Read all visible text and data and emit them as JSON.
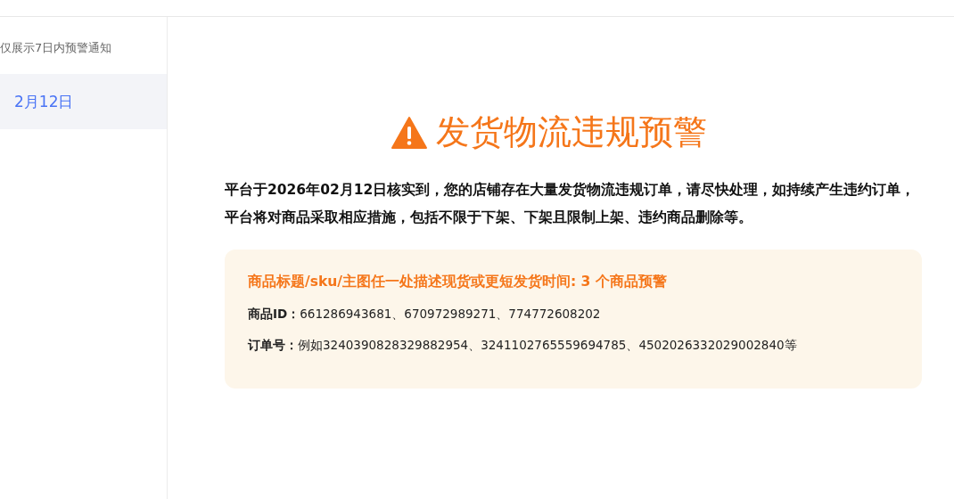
{
  "sidebar": {
    "note": "仅展示7日内预警通知",
    "items": [
      {
        "label": "2月12日",
        "selected": true
      }
    ]
  },
  "alert": {
    "title": "发货物流违规预警",
    "message": "平台于2026年02月12日核实到，您的店铺存在大量发货物流违规订单，请尽快处理，如持续产生违约订单，平台将对商品采取相应措施，包括不限于下架、下架且限制上架、违约商品删除等。",
    "card": {
      "heading": "商品标题/sku/主图任一处描述现货或更短发货时间: 3 个商品预警",
      "lines": [
        "**商品ID：**661286943681、670972989271、774772608202",
        "**订单号：**例如3240390828329882954、3241102765559694785、4502026332029002840等"
      ]
    }
  }
}
